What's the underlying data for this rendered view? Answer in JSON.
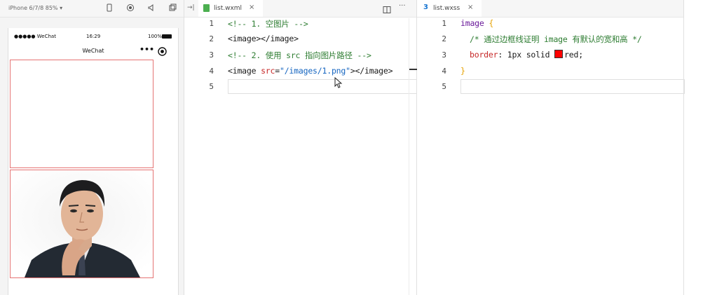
{
  "simulator": {
    "device_label": "iPhone 6/7/8 85% ▾",
    "status_bar": {
      "carrier": "●●●●● WeChat",
      "time": "16:29",
      "battery": "100%"
    },
    "nav_title": "WeChat",
    "capsule_more": "•••",
    "capsule_close": "⊙"
  },
  "wxml_editor": {
    "tab_label": "list.wxml",
    "tab_close": "×",
    "collapse": "→|",
    "split_icon": "▢",
    "more_icon": "···",
    "lines": [
      {
        "no": "1",
        "text": "<!-- 1. 空图片 -->"
      },
      {
        "no": "2",
        "text": "<image></image>"
      },
      {
        "no": "3",
        "text": "<!-- 2. 使用 src 指向图片路径 -->"
      },
      {
        "no": "4",
        "parts": {
          "open": "<image ",
          "attr": "src",
          "eq": "=",
          "val": "\"/images/1.png\"",
          "close": "></image>"
        }
      },
      {
        "no": "5",
        "text": ""
      }
    ]
  },
  "wxss_editor": {
    "tab_label": "list.wxss",
    "tab_close": "×",
    "lines": [
      {
        "no": "1",
        "selector": "image",
        "brace": "{"
      },
      {
        "no": "2",
        "text": "/* 通过边框线证明 image 有默认的宽和高 */"
      },
      {
        "no": "3",
        "prop": "border",
        "colon": ": ",
        "value_pre": "1px solid ",
        "swatch_color": "#ff0000",
        "value_post": "red;"
      },
      {
        "no": "4",
        "brace": "}"
      },
      {
        "no": "5",
        "text": ""
      }
    ]
  },
  "colors": {
    "border_red": "#e57373",
    "comment_green": "#2e7d32"
  }
}
